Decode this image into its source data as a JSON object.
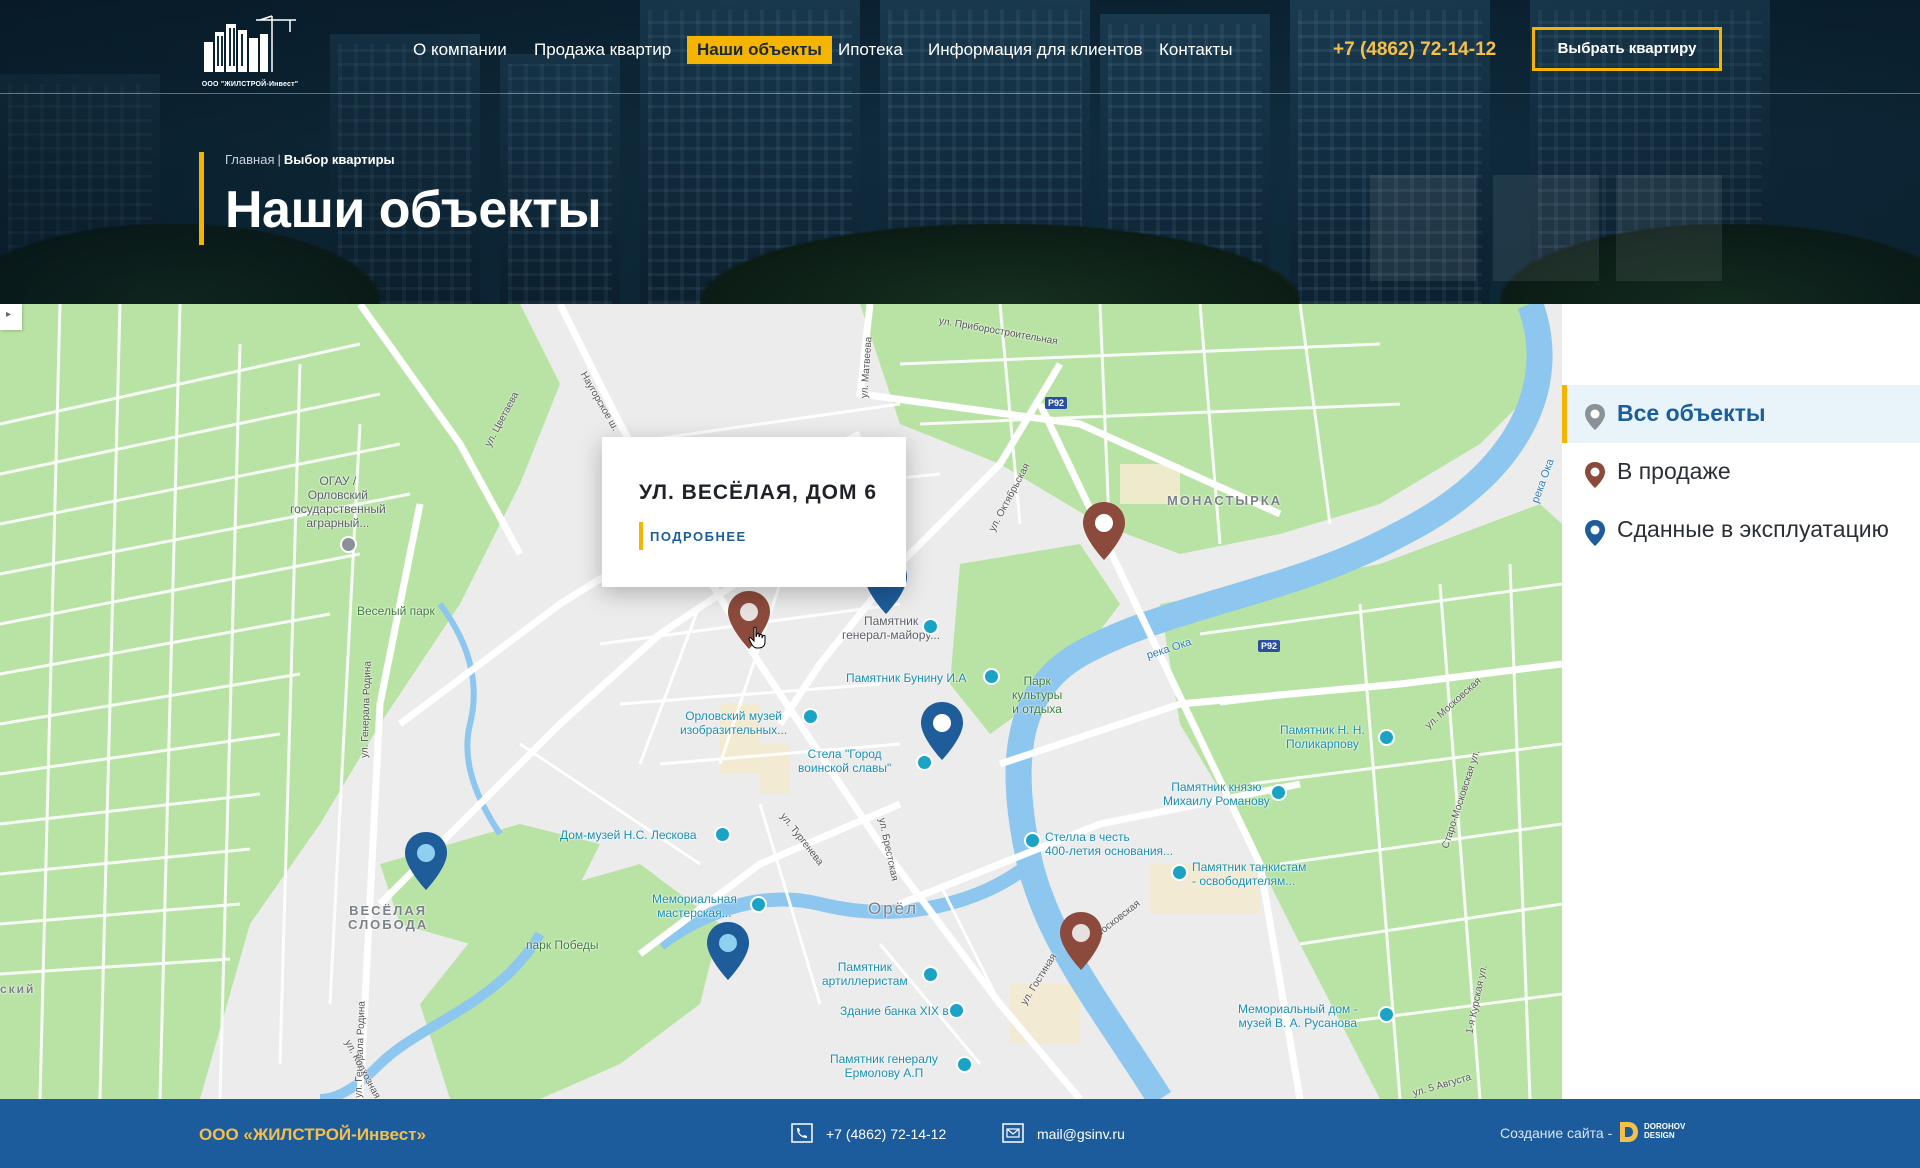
{
  "header": {
    "logo_caption": "ООО \"ЖИЛСТРОЙ-Инвест\"",
    "nav": [
      {
        "label": "О компании",
        "active": false
      },
      {
        "label": "Продажа квартир",
        "active": false
      },
      {
        "label": "Наши объекты",
        "active": true
      },
      {
        "label": "Ипотека",
        "active": false
      },
      {
        "label": "Информация для клиентов",
        "active": false
      },
      {
        "label": "Контакты",
        "active": false
      }
    ],
    "phone": "+7 (4862) 72-14-12",
    "cta": "Выбрать квартиру"
  },
  "breadcrumb": {
    "home": "Главная",
    "separator": "|",
    "current": "Выбор квартиры"
  },
  "page_title": "Наши объекты",
  "map": {
    "popup": {
      "title": "УЛ. ВЕСЁЛАЯ, ДОМ 6",
      "link": "ПОДРОБНЕЕ"
    },
    "pin_colors": {
      "sale": "#8b4a3c",
      "done": "#1e5c9a",
      "all": "#8a9298"
    },
    "labels": {
      "street_priborostroitelnaya": "ул. Приборостроительная",
      "street_matveeva": "ул. Матвеева",
      "street_tsvetaeva": "ул. Цветаева",
      "street_naugorskoe": "Наугорское ш.",
      "street_oktyabrskaya": "ул. Октябрьская",
      "shield_p92_a": "Р92",
      "shield_p92_b": "Р92",
      "district_monastyrka": "МОНАСТЫРКА",
      "river_oka_1": "река Ока",
      "river_oka_2": "река Ока",
      "ogau": "ОГАУ /\nОрловский\nгосударственный\nаграрный...",
      "veselyi_park": "Веселый парк",
      "pamyatnik_generalu": "Памятник\nгенерал-майору...",
      "pamyatnik_buninu": "Памятник Бунину И.А",
      "park_kultury": "Парк\nкультуры\nи отдыха",
      "orlovsky_muzey": "Орловский музей\nизобразительных...",
      "stela": "Стела \"Город\nвоинской славы\"",
      "pamyatnik_polikarpovu": "Памятник Н. Н.\nПоликарпову",
      "pamyatnik_knyazyu": "Памятник князю\nМихаилу Романову",
      "stella_400": "Стелла в честь\n400-летия основания...",
      "pamyatnik_tankistam": "Памятник танкистам\n- освободителям...",
      "dom_muzey_leskova": "Дом-музей Н.С. Лескова",
      "street_turgeneva": "ул. Тургенева",
      "street_brestskaya": "ул. Брестская",
      "district_veselaya_sloboda": "ВЕСЁЛАЯ\nСЛОБОДА",
      "memorialnaya_masterskaya": "Мемориальная\nмастерская...",
      "city_orel": "Орёл",
      "park_pobedy": "парк Победы",
      "pamyatnik_artilleristam": "Памятник\nартиллеристам",
      "zdanie_banka": "Здание банка XIX век",
      "pamyatnik_ermolovu": "Памятник генералу\nЕрмолову А.П",
      "memorialny_dom": "Мемориальный дом -\nмузей В. А. Русанова",
      "street_generala_rodina": "ул. Генерала Родина",
      "street_moskovskaya": "ул. Московская",
      "street_staro_moskovskaya": "Старо-Московская ул.",
      "street_gostinaya": "ул. Гостиная",
      "street_kurskaya": "1-я Курская ул.",
      "street_5_avgusta": "ул. 5 Августа",
      "street_kolhoznaya": "ул. Колхозная",
      "street_moskovskaya_2": "Московская",
      "edge_label": "ский"
    }
  },
  "filters": [
    {
      "label": "Все объекты",
      "color": "#8a9298",
      "active": true
    },
    {
      "label": "В продаже",
      "color": "#8b4a3c",
      "active": false
    },
    {
      "label": "Сданные в эксплуатацию",
      "color": "#1e5c9a",
      "active": false
    }
  ],
  "footer": {
    "company": "ООО «ЖИЛСТРОЙ-Инвест»",
    "phone": "+7 (4862) 72-14-12",
    "email": "mail@gsinv.ru",
    "credit": "Создание сайта -",
    "dev_logo": "DOROHOV\nDESIGN"
  }
}
